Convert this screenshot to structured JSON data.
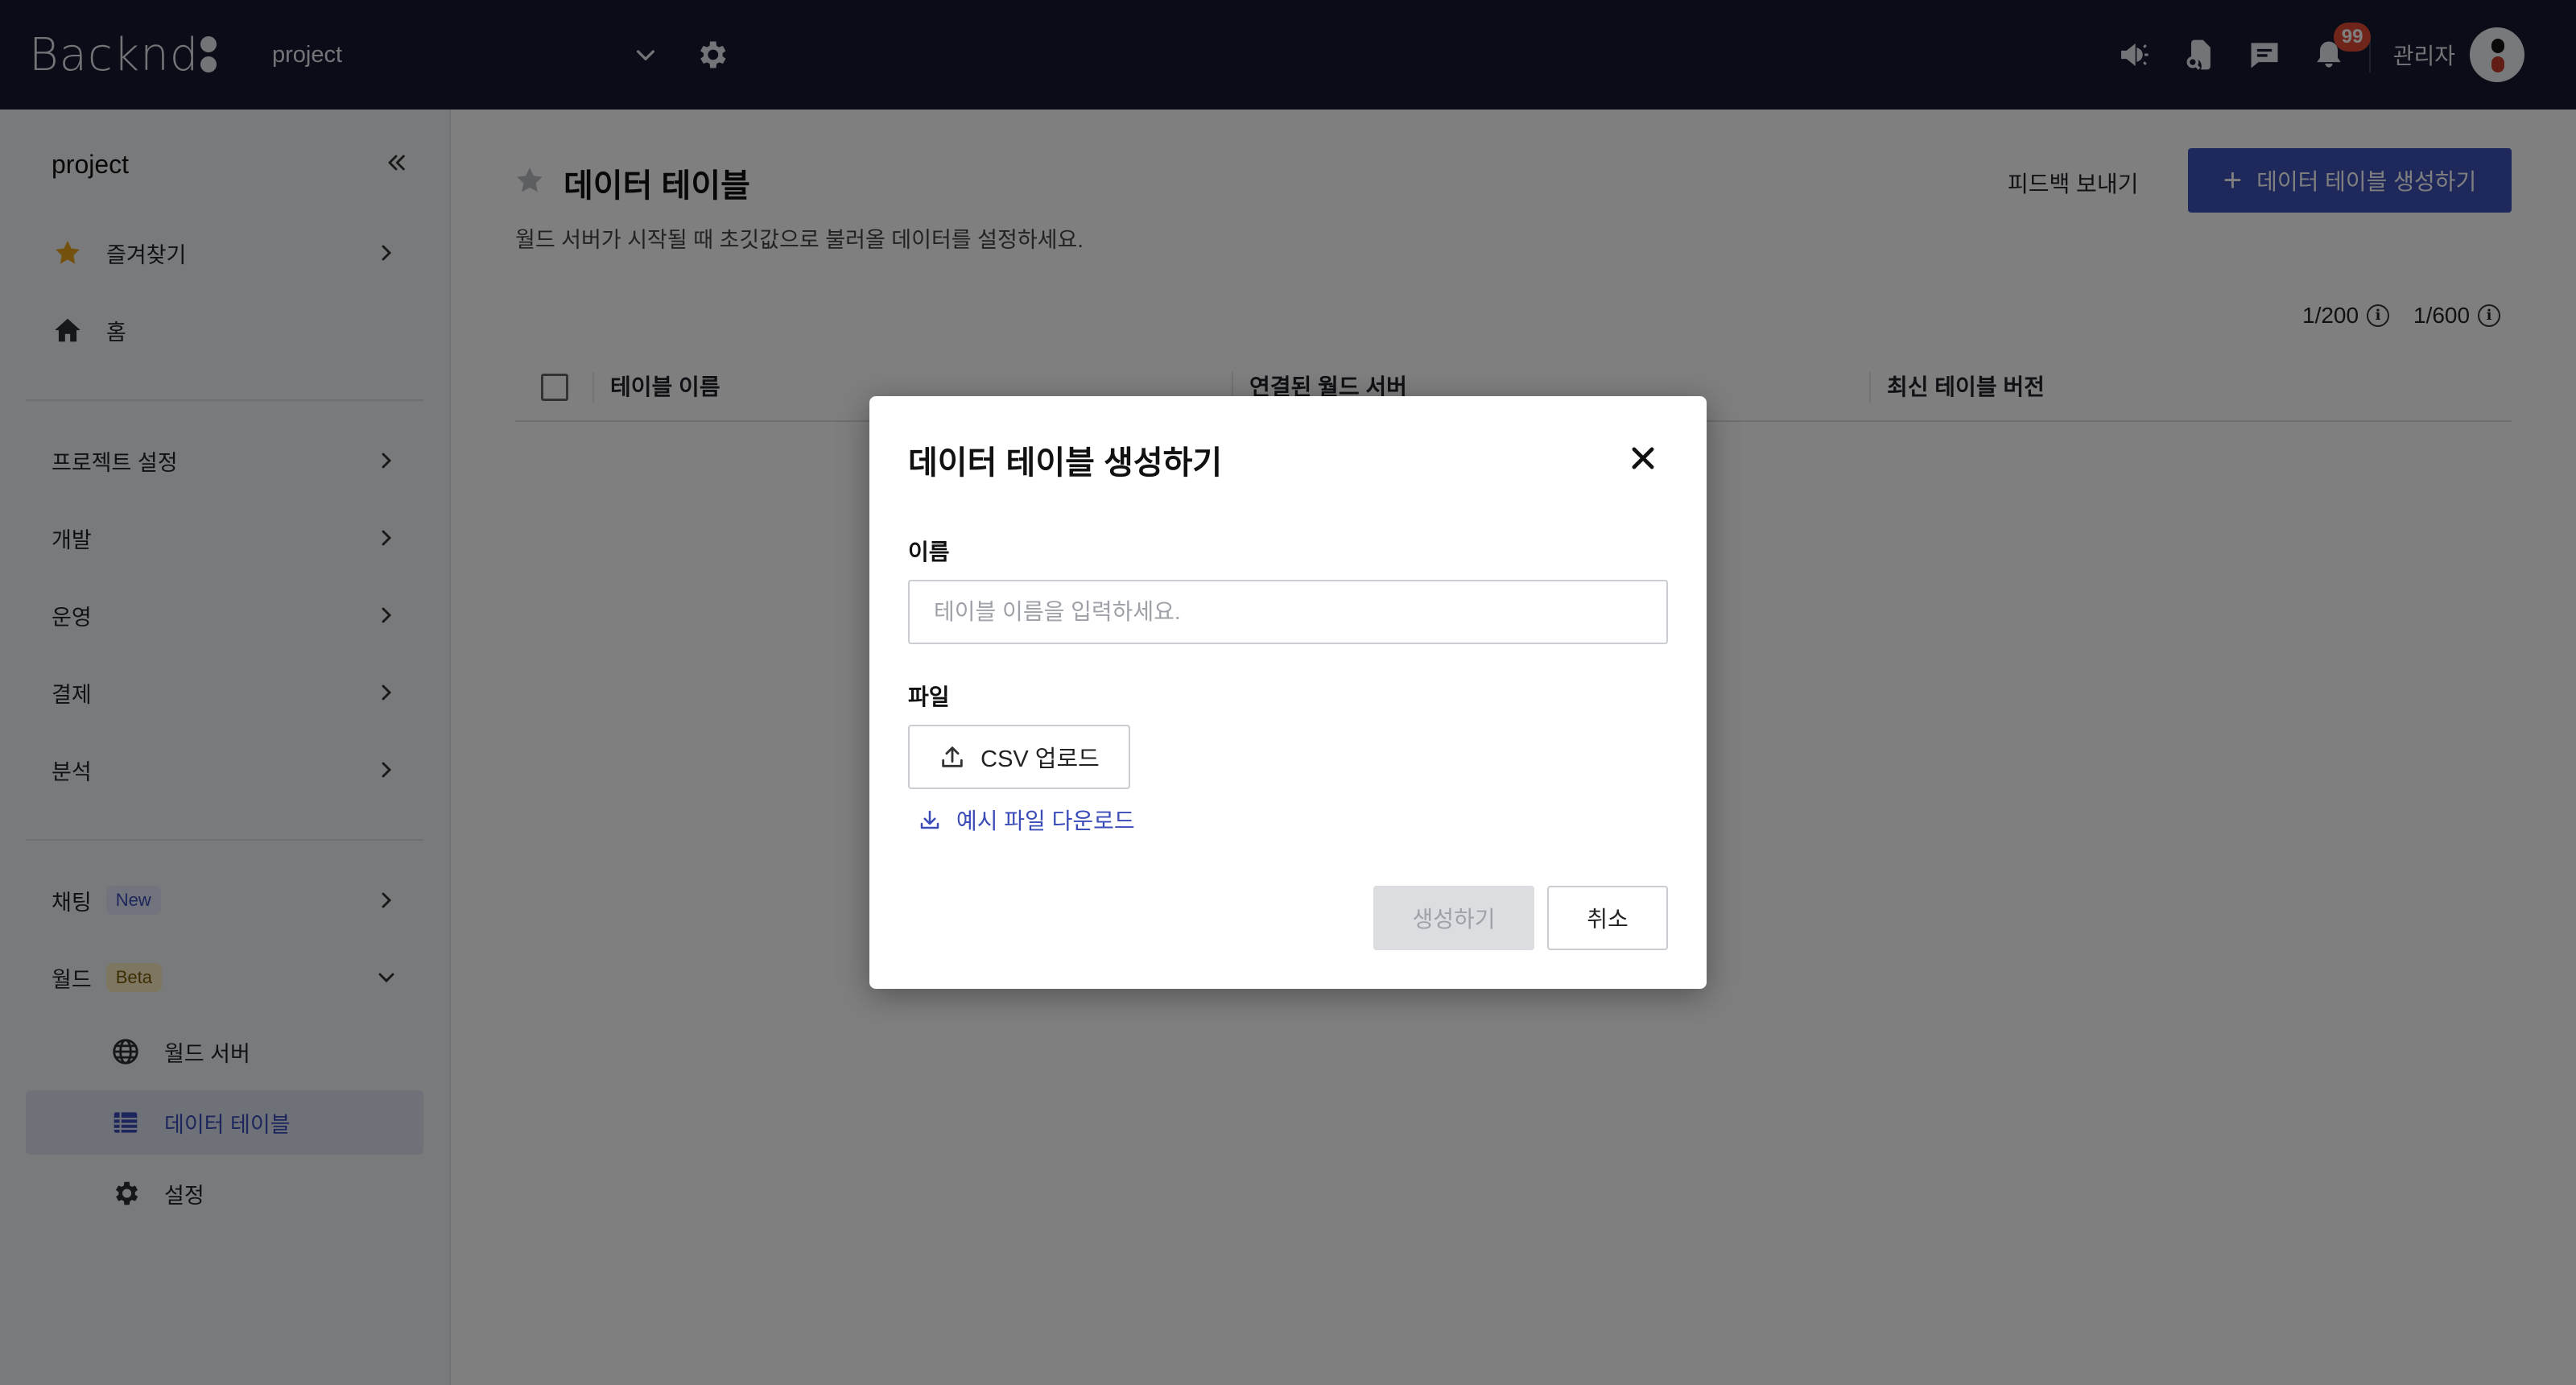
{
  "topbar": {
    "logo_text": "Backnd",
    "project_name": "project",
    "notification_count": "99",
    "admin_label": "관리자",
    "icons": [
      "chevron-down-icon",
      "gear-icon",
      "megaphone-icon",
      "document-search-icon",
      "chat-icon",
      "bell-icon"
    ]
  },
  "sidebar": {
    "header": "project",
    "favorites": "즐겨찾기",
    "home": "홈",
    "project_settings": "프로젝트 설정",
    "development": "개발",
    "operation": "운영",
    "payment": "결제",
    "analytics": "분석",
    "chat": "채팅",
    "chat_tag": "New",
    "world": "월드",
    "world_tag": "Beta",
    "world_server": "월드 서버",
    "data_table": "데이터 테이블",
    "settings": "설정"
  },
  "main": {
    "title": "데이터 테이블",
    "description": "월드 서버가 시작될 때 초깃값으로 불러올 데이터를 설정하세요.",
    "feedback_label": "피드백 보내기",
    "create_label": "데이터 테이블 생성하기",
    "quota_table": "1/200",
    "quota_rows": "1/600",
    "columns": [
      "테이블 이름",
      "연결된 월드 서버",
      "최신 테이블 버전"
    ]
  },
  "modal": {
    "title": "데이터 테이블 생성하기",
    "name_label": "이름",
    "name_placeholder": "테이블 이름을 입력하세요.",
    "name_value": "",
    "file_label": "파일",
    "upload_label": "CSV 업로드",
    "sample_link": "예시 파일 다운로드",
    "submit_label": "생성하기",
    "cancel_label": "취소"
  },
  "colors": {
    "topbar_bg": "#141a2e",
    "primary": "#3f51b5",
    "link": "#3b4cb8",
    "badge": "#e04a36",
    "star": "#e8a21a",
    "active_bg": "#dfe3f3"
  }
}
